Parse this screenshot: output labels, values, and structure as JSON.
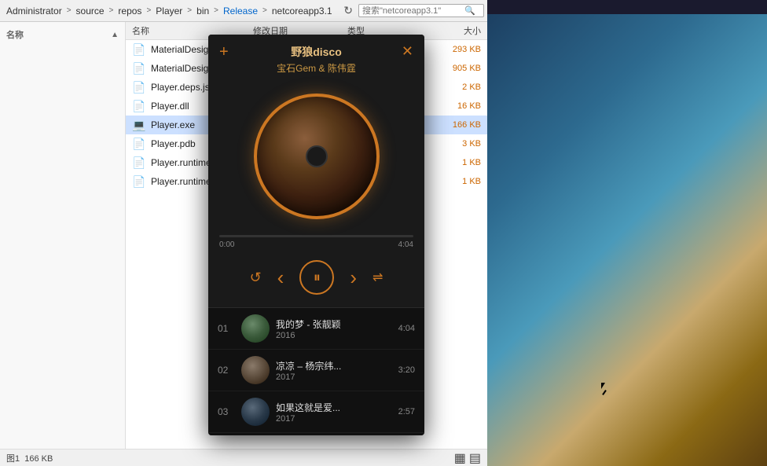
{
  "addressBar": {
    "breadcrumbs": [
      {
        "label": "Administrator",
        "active": false
      },
      {
        "sep": ">"
      },
      {
        "label": "source",
        "active": false
      },
      {
        "sep": ">"
      },
      {
        "label": "repos",
        "active": false
      },
      {
        "sep": ">"
      },
      {
        "label": "Player",
        "active": false
      },
      {
        "sep": ">"
      },
      {
        "label": "bin",
        "active": false
      },
      {
        "sep": ">"
      },
      {
        "label": "Release",
        "active": true
      },
      {
        "sep": ">"
      },
      {
        "label": "netcoreapp3.1",
        "active": false
      }
    ],
    "searchPlaceholder": "搜索\"netcoreapp3.1\"",
    "refreshIcon": "↻"
  },
  "fileList": {
    "headers": {
      "name": "名称",
      "date": "修改日期",
      "type": "类型",
      "size": "大小"
    },
    "files": [
      {
        "icon": "📄",
        "name": "MaterialDesignColors.dll",
        "date": "",
        "type": "",
        "size": "293 KB",
        "selected": false
      },
      {
        "icon": "📄",
        "name": "MaterialDesignThemes.Wpf.dll",
        "date": "",
        "type": "",
        "size": "905 KB",
        "selected": false
      },
      {
        "icon": "📄",
        "name": "Player.deps.json",
        "date": "",
        "type": "",
        "size": "2 KB",
        "selected": false
      },
      {
        "icon": "📄",
        "name": "Player.dll",
        "date": "",
        "type": "",
        "size": "16 KB",
        "selected": false
      },
      {
        "icon": "💻",
        "name": "Player.exe",
        "date": "",
        "type": "",
        "size": "166 KB",
        "selected": true
      },
      {
        "icon": "📄",
        "name": "Player.pdb",
        "date": "",
        "type": "",
        "size": "3 KB",
        "selected": false
      },
      {
        "icon": "📄",
        "name": "Player.runtimeconfig.dev.json",
        "date": "",
        "type": "",
        "size": "1 KB",
        "selected": false
      },
      {
        "icon": "📄",
        "name": "Player.runtimeconfig.json",
        "date": "",
        "type": "",
        "size": "1 KB",
        "selected": false
      }
    ]
  },
  "statusBar": {
    "text": "图1",
    "size": "166 KB",
    "viewIcons": [
      "▦",
      "▤"
    ]
  },
  "sidebarHeader": {
    "label": "名称",
    "collapseArrow": "▲"
  },
  "player": {
    "addBtn": "+",
    "closeBtn": "✕",
    "title": "野狼disco",
    "artist": "宝石Gem & 陈伟霆",
    "progressPercent": 0,
    "progressStart": "0:00",
    "progressEnd": "4:04",
    "controls": {
      "repeat": "↺",
      "prev": "‹",
      "playPause": "⏸",
      "next": "›",
      "shuffle": "⇌"
    },
    "playlist": [
      {
        "num": "01",
        "song": "我的梦 - 张靓颖",
        "year": "2016",
        "duration": "4:04"
      },
      {
        "num": "02",
        "song": "凉凉 – 杨宗纬...",
        "year": "2017",
        "duration": "3:20"
      },
      {
        "num": "03",
        "song": "如果这就是爱...",
        "year": "2017",
        "duration": "2:57"
      }
    ]
  }
}
